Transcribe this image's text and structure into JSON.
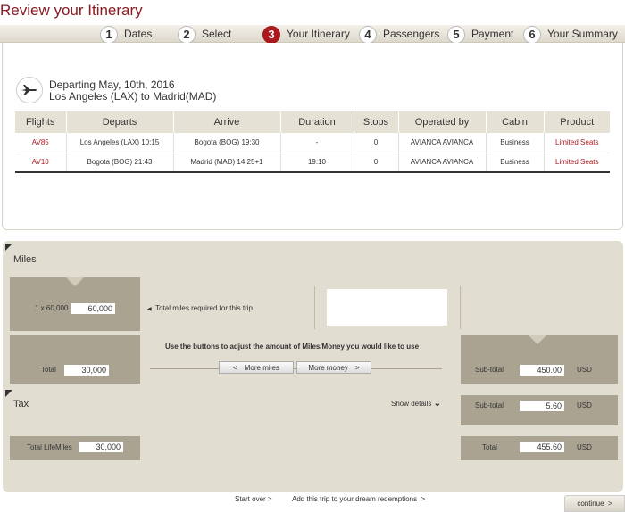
{
  "page_title": "Review your Itinerary",
  "steps": [
    {
      "num": "1",
      "label": "Dates"
    },
    {
      "num": "2",
      "label": "Select"
    },
    {
      "num": "3",
      "label": "Your Itinerary"
    },
    {
      "num": "4",
      "label": "Passengers"
    },
    {
      "num": "5",
      "label": "Payment"
    },
    {
      "num": "6",
      "label": "Your Summary"
    }
  ],
  "departure": {
    "date_line": "Departing May, 10th, 2016",
    "route_line": "Los Angeles (LAX) to Madrid(MAD)"
  },
  "table": {
    "headers": [
      "Flights",
      "Departs",
      "Arrive",
      "Duration",
      "Stops",
      "Operated by",
      "Cabin",
      "Product"
    ],
    "rows": [
      [
        "AV85",
        "Los Angeles (LAX) 10:15",
        "Bogota (BOG) 19:30",
        "-",
        "0",
        "AVIANCA AVIANCA",
        "Business",
        "Limited Seats"
      ],
      [
        "AV10",
        "Bogota (BOG) 21:43",
        "Madrid (MAD) 14:25+1",
        "19:10",
        "0",
        "AVIANCA AVIANCA",
        "Business",
        "Limited Seats"
      ]
    ]
  },
  "miles": {
    "header": "Miles",
    "calc_label": "1 x 60,000",
    "calc_value": "60,000",
    "required_label": "Total miles required for this trip",
    "adjust_text": "Use the buttons to adjust the amount of Miles/Money you would like to use",
    "total_label": "Total",
    "total_value": "30,000",
    "more_miles": "More miles",
    "more_money": "More money",
    "subtotal_label": "Sub-total",
    "subtotal_value": "450.00",
    "currency": "USD"
  },
  "tax": {
    "header": "Tax",
    "show_details": "Show details",
    "subtotal_label": "Sub-total",
    "subtotal_value": "5.60",
    "currency": "USD"
  },
  "totals": {
    "lifemiles_label": "Total LifeMiles",
    "lifemiles_value": "30,000",
    "total_label": "Total",
    "total_value": "455.60",
    "currency": "USD"
  },
  "footer": {
    "start_over": "Start over",
    "add_dream": "Add this trip to your dream redemptions",
    "continue": "continue"
  }
}
